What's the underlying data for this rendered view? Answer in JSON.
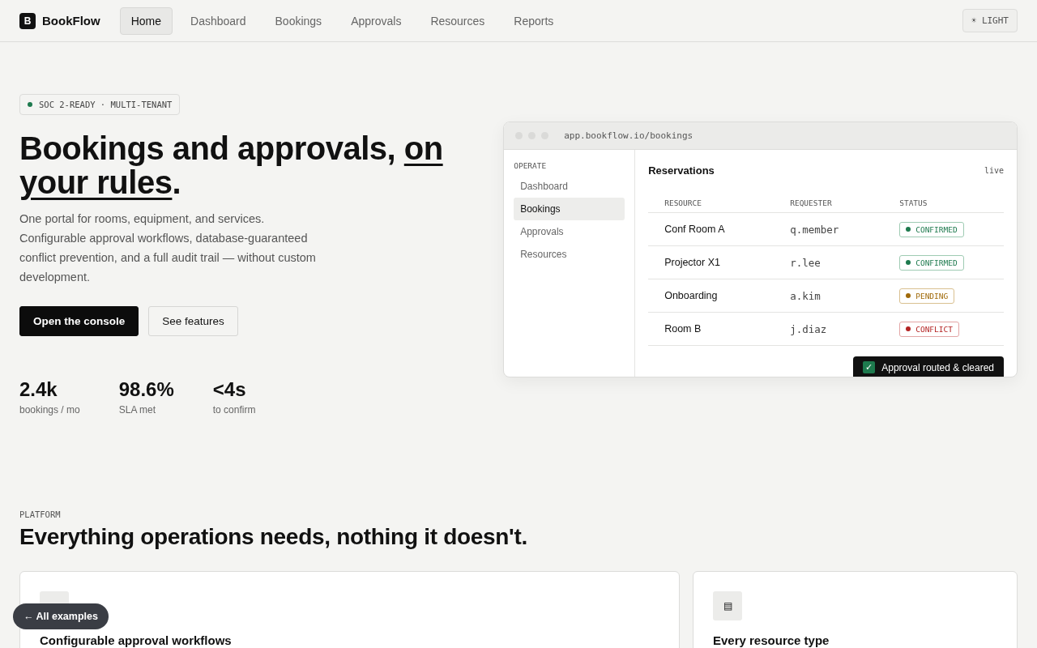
{
  "brand": {
    "logo": "B",
    "name": "BookFlow"
  },
  "nav": [
    {
      "label": "Home",
      "selected": true
    },
    {
      "label": "Dashboard",
      "selected": false
    },
    {
      "label": "Bookings",
      "selected": false
    },
    {
      "label": "Approvals",
      "selected": false
    },
    {
      "label": "Resources",
      "selected": false
    },
    {
      "label": "Reports",
      "selected": false
    }
  ],
  "theme_button": {
    "icon": "☀",
    "label": "LIGHT"
  },
  "hero": {
    "badge": "SOC 2-READY · MULTI-TENANT",
    "headline": {
      "start": "Bookings and approvals, ",
      "underlined": "on your rules",
      "end": "."
    },
    "lead": "One portal for rooms, equipment, and services. Configurable approval workflows, database-guaranteed conflict prevention, and a full audit trail — without custom development.",
    "buttons": [
      {
        "label": "Open the console",
        "kind": "primary"
      },
      {
        "label": "See features",
        "kind": "secondary"
      }
    ],
    "stats": [
      {
        "value": "2.4k",
        "label": "bookings / mo"
      },
      {
        "value": "98.6%",
        "label": "SLA met"
      },
      {
        "value": "<4s",
        "label": "to confirm"
      }
    ]
  },
  "preview": {
    "url": "app.bookflow.io/bookings",
    "sidebar": {
      "heading": "OPERATE",
      "items": [
        {
          "label": "Dashboard",
          "selected": false
        },
        {
          "label": "Bookings",
          "selected": true
        },
        {
          "label": "Approvals",
          "selected": false
        },
        {
          "label": "Resources",
          "selected": false
        }
      ]
    },
    "title": "Reservations",
    "live": "live",
    "columns": [
      "RESOURCE",
      "REQUESTER",
      "STATUS"
    ],
    "rows": [
      {
        "resource": "Conf Room A",
        "requester": "q.member",
        "status": "CONFIRMED",
        "kind": "ok"
      },
      {
        "resource": "Projector X1",
        "requester": "r.lee",
        "status": "CONFIRMED",
        "kind": "ok"
      },
      {
        "resource": "Onboarding",
        "requester": "a.kim",
        "status": "PENDING",
        "kind": "warn"
      },
      {
        "resource": "Room B",
        "requester": "j.diaz",
        "status": "CONFLICT",
        "kind": "error"
      }
    ],
    "toast": {
      "icon": "✓",
      "text": "Approval routed & cleared"
    }
  },
  "platform": {
    "eyebrow": "PLATFORM",
    "title": "Everything operations needs, nothing it doesn't.",
    "cards": [
      {
        "title": "Configurable approval workflows"
      },
      {
        "title": "Every resource type",
        "icon": "▤"
      }
    ]
  },
  "back_button": "← All examples"
}
